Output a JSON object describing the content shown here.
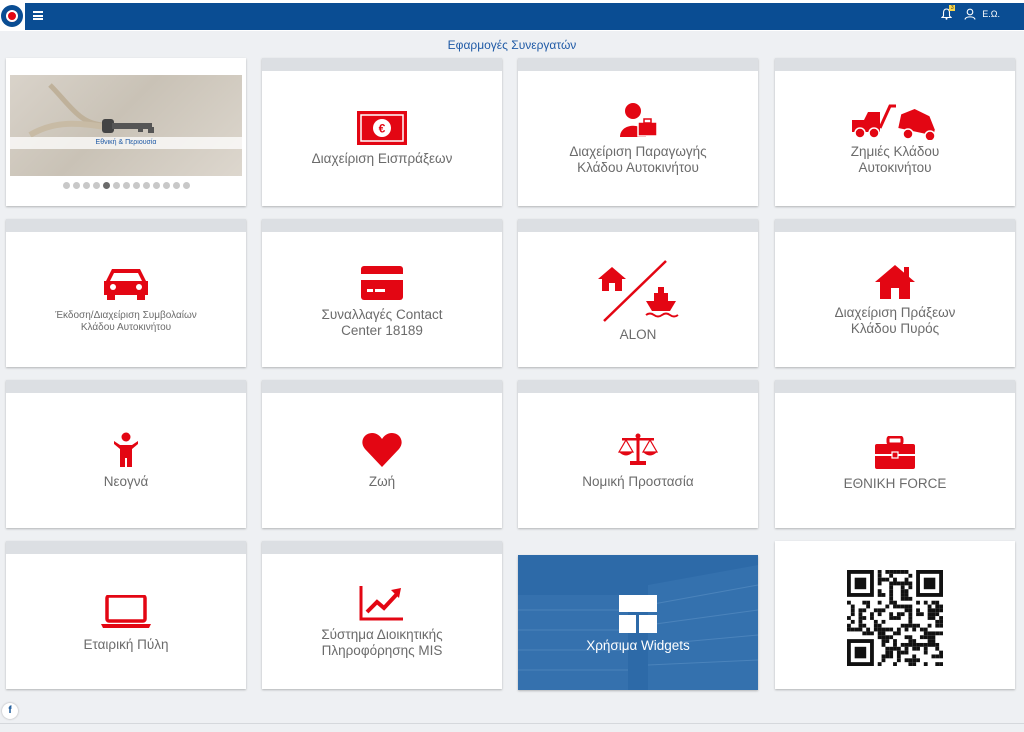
{
  "header": {
    "user_label": "Ε.Ω.",
    "notification_badge": "3",
    "brand_color": "#0a4d93",
    "accent_color": "#e30613"
  },
  "page": {
    "title": "Εφαρμογές Συνεργατών"
  },
  "carousel": {
    "caption": "Εθνική & Περιουσία",
    "dot_count": 13,
    "active_dot": 5
  },
  "tiles": {
    "eispraxeis": {
      "label": "Διαχείριση Εισπράξεων",
      "icon": "euro-banknote-icon"
    },
    "paragogi": {
      "label": "Διαχείριση Παραγωγής\nΚλάδου Αυτοκινήτου",
      "icon": "agent-briefcase-icon"
    },
    "zimies": {
      "label": "Ζημιές Κλάδου\nΑυτοκινήτου",
      "icon": "tow-truck-icon"
    },
    "ekdosi": {
      "label": "Έκδοση/Διαχείριση Συμβολαίων\nΚλάδου Αυτοκινήτου",
      "icon": "car-icon"
    },
    "contact": {
      "label": "Συναλλαγές Contact\nCenter 18189",
      "icon": "credit-card-icon"
    },
    "alon": {
      "label": "ALON",
      "icon": "house-ship-icon"
    },
    "pyros": {
      "label": "Διαχείριση Πράξεων\nΚλάδου Πυρός",
      "icon": "house-icon"
    },
    "neogna": {
      "label": "Νεογνά",
      "icon": "child-icon"
    },
    "zoi": {
      "label": "Ζωή",
      "icon": "heart-icon"
    },
    "nomiki": {
      "label": "Νομική Προστασία",
      "icon": "scales-icon"
    },
    "force": {
      "label": "ΕΘΝΙΚΗ FORCE",
      "icon": "briefcase-icon"
    },
    "pyli": {
      "label": "Εταιρική Πύλη",
      "icon": "laptop-icon"
    },
    "mis": {
      "label": "Σύστημα Διοικητικής\nΠληροφόρησης MIS",
      "icon": "trend-chart-icon"
    },
    "widgets": {
      "label": "Χρήσιμα Widgets",
      "icon": "widgets-grid-icon"
    },
    "qr": {
      "icon": "qr-code-icon"
    }
  },
  "footer": {
    "facebook": "f"
  }
}
